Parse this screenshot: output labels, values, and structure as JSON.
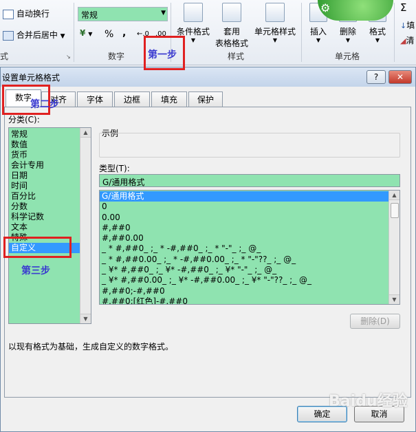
{
  "ribbon": {
    "alignment": {
      "wrap_text": "自动换行",
      "merge_center": "合并后居中",
      "group_label": "式"
    },
    "number": {
      "format_value": "常规",
      "currency_symbol": "¥",
      "percent_symbol": "%",
      "comma_symbol": ",",
      "dec_inc": "←.0",
      "dec_dec": ".00",
      "group_label": "数字"
    },
    "styles": {
      "conditional_format": "条件格式",
      "table_format_line1": "套用",
      "table_format_line2": "表格格式",
      "cell_styles": "单元格样式",
      "group_label": "样式"
    },
    "cells": {
      "insert": "插入",
      "delete": "删除",
      "format": "格式",
      "group_label": "单元格"
    },
    "edge": {
      "sigma": "Σ",
      "fill": "填",
      "clear": "清"
    }
  },
  "dialog": {
    "title": "设置单元格格式",
    "help_label": "?",
    "close_label": "✕",
    "tabs": [
      {
        "label": "数字"
      },
      {
        "label": "对齐"
      },
      {
        "label": "字体"
      },
      {
        "label": "边框"
      },
      {
        "label": "填充"
      },
      {
        "label": "保护"
      }
    ],
    "category_label": "分类(C):",
    "categories": [
      "常规",
      "数值",
      "货币",
      "会计专用",
      "日期",
      "时间",
      "百分比",
      "分数",
      "科学记数",
      "文本",
      "特殊",
      "自定义"
    ],
    "selected_category": "自定义",
    "sample_label": "示例",
    "type_label": "类型(T):",
    "type_value": "G/通用格式",
    "formats": [
      "G/通用格式",
      "0",
      "0.00",
      "#,##0",
      "#,##0.00",
      "_ * #,##0_ ;_ * -#,##0_ ;_ * \"-\"_ ;_ @_",
      "_ * #,##0.00_ ;_ * -#,##0.00_ ;_ * \"-\"??_ ;_ @_",
      "_ ¥* #,##0_ ;_ ¥* -#,##0_ ;_ ¥* \"-\"_ ;_ @_",
      "_ ¥* #,##0.00_ ;_ ¥* -#,##0.00_ ;_ ¥* \"-\"??_ ;_ @_",
      "#,##0;-#,##0",
      "#,##0;[红色]-#,##0"
    ],
    "delete_label": "删除(D)",
    "description": "以现有格式为基础，生成自定义的数字格式。",
    "ok_label": "确定",
    "cancel_label": "取消"
  },
  "annotations": {
    "step1": "第一步",
    "step2": "第二步",
    "step3": "第三步"
  },
  "watermark": "Baidu经验"
}
